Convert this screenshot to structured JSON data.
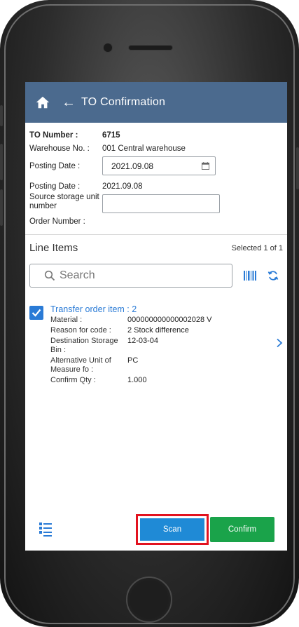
{
  "app": {
    "title": "TO Confirmation",
    "accent_color": "#4b6a8e",
    "home_icon": "home-icon",
    "back_icon": "back-arrow-icon"
  },
  "header": {
    "to_number_label": "TO Number :",
    "to_number_value": "6715",
    "warehouse_label": "Warehouse No. :",
    "warehouse_value": "001 Central warehouse",
    "posting_date_input_label": "Posting Date :",
    "posting_date_input_value": "2021.09.08",
    "posting_date_label": "Posting Date :",
    "posting_date_value": "2021.09.08",
    "source_su_label_line1": "Source storage unit",
    "source_su_label_line2": "number",
    "source_su_value": "",
    "order_number_label": "Order Number :"
  },
  "line_items": {
    "title": "Line Items",
    "selected_text": "Selected 1  of 1",
    "search_placeholder": "Search",
    "items": [
      {
        "title": "Transfer order item : 2",
        "checked": true,
        "fields": [
          {
            "label": "Material :",
            "value": "000000000000002028 V"
          },
          {
            "label": "Reason for code :",
            "value": "2 Stock difference"
          },
          {
            "label": "Destination Storage Bin :",
            "value": "12-03-04"
          },
          {
            "label": "Alternative Unit of Measure fo :",
            "value": "PC"
          },
          {
            "label": "Confirm Qty :",
            "value": "1.000"
          }
        ]
      }
    ]
  },
  "footer": {
    "scan_label": "Scan",
    "confirm_label": "Confirm",
    "scan_color": "#1f8ad6",
    "confirm_color": "#1aa34a",
    "highlight_color": "#e2121f"
  }
}
